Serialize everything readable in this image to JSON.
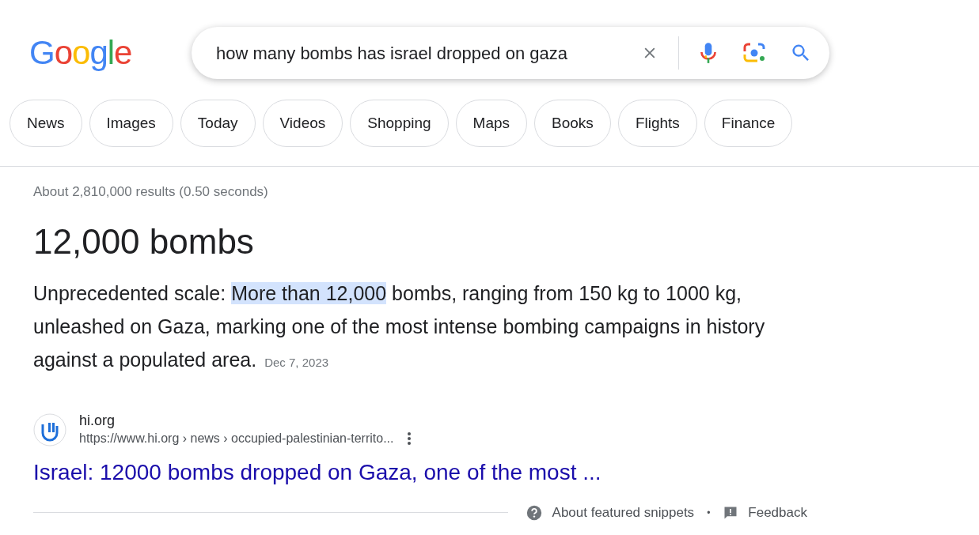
{
  "logo": "Google",
  "search": {
    "value": "how many bombs has israel dropped on gaza"
  },
  "tabs": [
    {
      "label": "News",
      "selected": false
    },
    {
      "label": "Images",
      "selected": false
    },
    {
      "label": "Today",
      "selected": false
    },
    {
      "label": "Videos",
      "selected": false
    },
    {
      "label": "Shopping",
      "selected": false
    },
    {
      "label": "Maps",
      "selected": false
    },
    {
      "label": "Books",
      "selected": false
    },
    {
      "label": "Flights",
      "selected": false
    },
    {
      "label": "Finance",
      "selected": false
    }
  ],
  "result_stats": "About 2,810,000 results (0.50 seconds)",
  "featured_snippet": {
    "answer": "12,000 bombs",
    "text": [
      {
        "text": "Unprecedented scale: ",
        "highlighted": false
      },
      {
        "text": "More than 12,000",
        "highlighted": true
      },
      {
        "text": " bombs, ranging from 150 kg to 1000 kg, unleashed on Gaza, marking one of the most intense bombing campaigns in history against a populated area.",
        "highlighted": false
      }
    ],
    "date": "Dec 7, 2023",
    "source": {
      "site": "hi.org",
      "url": "https://www.hi.org › news › occupied-palestinian-territo..."
    },
    "title": "Israel: 12000 bombs dropped on Gaza, one of the most ..."
  },
  "footer": {
    "about": "About featured snippets",
    "separator": "•",
    "feedback": "Feedback"
  }
}
